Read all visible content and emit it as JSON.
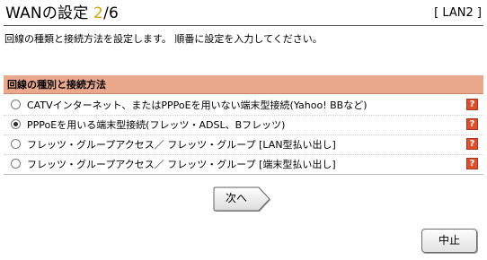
{
  "header": {
    "title_prefix": "WANの設定 ",
    "step_current": "2",
    "step_total": "/6",
    "lan_badge": "[ LAN2 ]"
  },
  "instruction": "回線の種類と接続方法を設定します。 順番に設定を入力してください。",
  "section": {
    "title": "回線の種別と接続方法",
    "options": [
      {
        "label": "CATVインターネット、またはPPPoEを用いない端末型接続(Yahoo! BBなど)",
        "selected": false
      },
      {
        "label": "PPPoEを用いる端末型接続(フレッツ・ADSL、Bフレッツ)",
        "selected": true
      },
      {
        "label": "フレッツ・グループアクセス／ フレッツ・グループ [LAN型払い出し]",
        "selected": false
      },
      {
        "label": "フレッツ・グループアクセス／ フレッツ・グループ [端末型払い出し]",
        "selected": false
      }
    ],
    "help_glyph": "?"
  },
  "buttons": {
    "next_label": "次へ",
    "stop_label": "中止"
  },
  "colors": {
    "section_header_bg": "#eaa98c",
    "step_accent": "#d8a400",
    "help_icon_bg": "#e14f2a"
  },
  "icons": {
    "help": "help-icon",
    "next_arrow": "arrow-right-icon"
  }
}
